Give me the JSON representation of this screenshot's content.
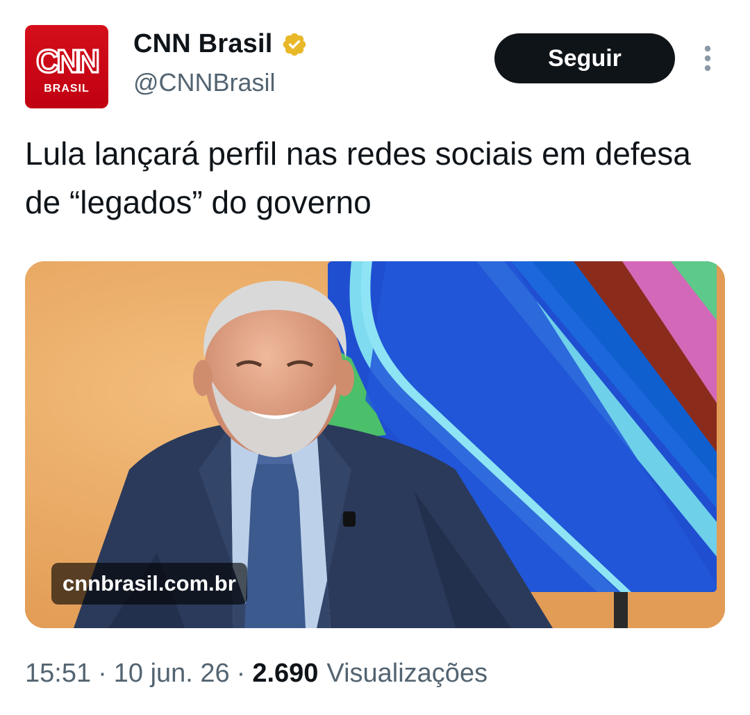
{
  "author": {
    "display_name": "CNN Brasil",
    "handle": "@CNNBrasil",
    "avatar_logo_text": "CNN",
    "avatar_sub_text": "BRASIL",
    "avatar_icon": "cnn-brasil-logo",
    "verified_icon": "verified-badge-gold"
  },
  "actions": {
    "follow_label": "Seguir",
    "more_icon": "more-vertical-icon"
  },
  "tweet": {
    "text": "Lula lançará perfil nas redes sociais em defesa de “legados” do governo"
  },
  "media": {
    "domain_label": "cnnbrasil.com.br"
  },
  "meta": {
    "time": "15:51",
    "separator": "·",
    "date": "10 jun. 26",
    "views_count": "2.690",
    "views_label": "Visualizações"
  },
  "colors": {
    "brand_red": "#cc0000",
    "verified_gold": "#e8b829",
    "follow_button_bg": "#0f1419",
    "secondary_text": "#536471"
  }
}
